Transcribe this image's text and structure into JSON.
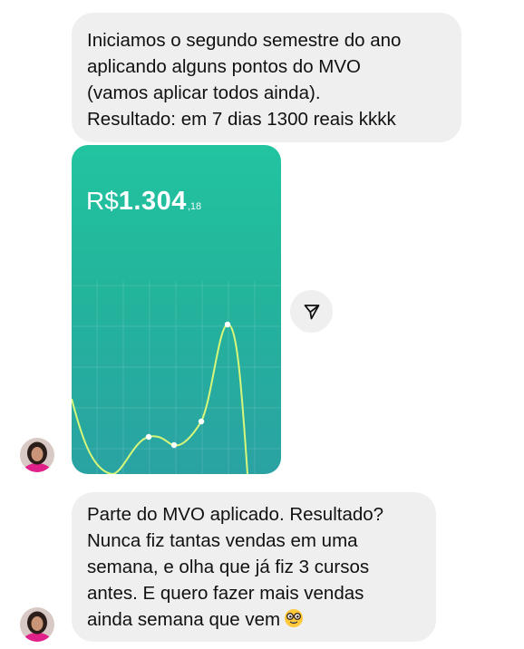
{
  "messages": [
    {
      "text": "Iniciamos o segundo semestre do ano\naplicando alguns pontos do MVO\n(vamos aplicar todos ainda).\nResultado: em 7 dias 1300 reais kkkk"
    },
    {
      "text": "Parte do MVO aplicado. Resultado?\nNunca fiz tantas vendas em uma\nsemana, e olha que já fiz 3 cursos\nantes. E quero fazer mais vendas\nainda semana que vem",
      "emoji": "nerd-face-emoji"
    }
  ],
  "sales_card": {
    "currency": "R$",
    "amount": "1.304",
    "cents": ",18",
    "colors": {
      "gradient_top": "#22c4a0",
      "gradient_bottom": "#2aa2a3",
      "line": "#d7f77a"
    }
  },
  "icons": {
    "share": "paper-plane-icon"
  },
  "colors": {
    "bubble_background": "#efefef",
    "text": "#111111"
  }
}
